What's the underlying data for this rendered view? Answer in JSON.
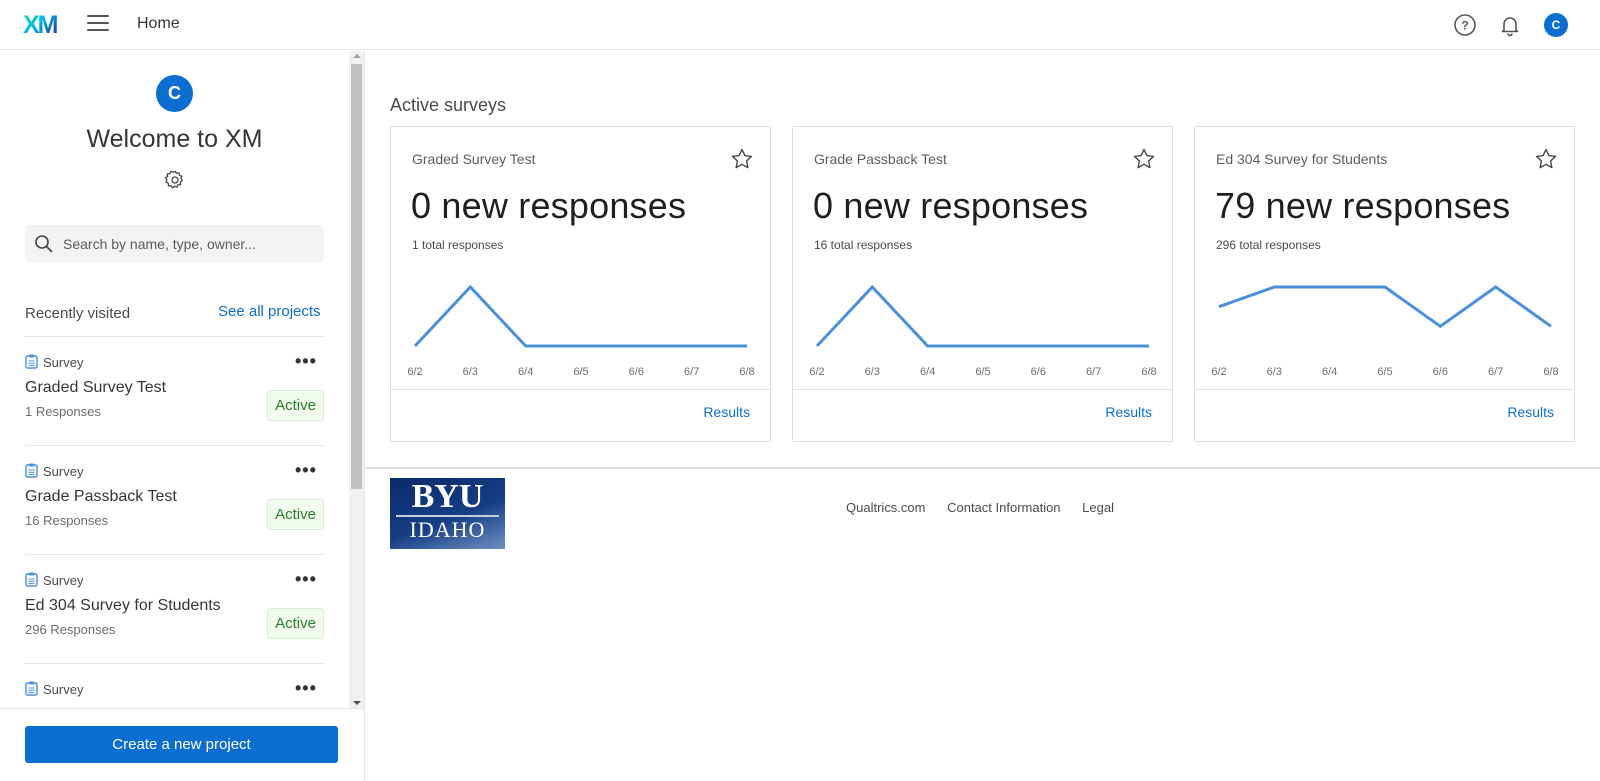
{
  "topbar": {
    "logo": "XM",
    "page_label": "Home",
    "avatar_initial": "C"
  },
  "sidebar": {
    "avatar_initial": "C",
    "welcome": "Welcome to XM",
    "search_placeholder": "Search by name, type, owner...",
    "recent_label": "Recently visited",
    "see_all": "See all projects",
    "projects": [
      {
        "type": "Survey",
        "name": "Graded Survey Test",
        "responses": "1 Responses",
        "status": "Active"
      },
      {
        "type": "Survey",
        "name": "Grade Passback Test",
        "responses": "16 Responses",
        "status": "Active"
      },
      {
        "type": "Survey",
        "name": "Ed 304 Survey for Students",
        "responses": "296 Responses",
        "status": "Active"
      },
      {
        "type": "Survey",
        "name": "",
        "responses": "",
        "status": ""
      }
    ],
    "create_button": "Create a new project"
  },
  "main": {
    "section_title": "Active surveys",
    "cards": [
      {
        "title": "Graded Survey Test",
        "new_responses": "0 new responses",
        "total_responses": "1 total responses",
        "results_label": "Results"
      },
      {
        "title": "Grade Passback Test",
        "new_responses": "0 new responses",
        "total_responses": "16 total responses",
        "results_label": "Results"
      },
      {
        "title": "Ed 304 Survey for Students",
        "new_responses": "79 new responses",
        "total_responses": "296 total responses",
        "results_label": "Results"
      }
    ]
  },
  "chart_data": [
    {
      "type": "line",
      "title": "Graded Survey Test",
      "categories": [
        "6/2",
        "6/3",
        "6/4",
        "6/5",
        "6/6",
        "6/7",
        "6/8"
      ],
      "values": [
        0,
        1,
        0,
        0,
        0,
        0,
        0
      ],
      "xlabel": "",
      "ylabel": ""
    },
    {
      "type": "line",
      "title": "Grade Passback Test",
      "categories": [
        "6/2",
        "6/3",
        "6/4",
        "6/5",
        "6/6",
        "6/7",
        "6/8"
      ],
      "values": [
        0,
        1,
        0,
        0,
        0,
        0,
        0
      ],
      "xlabel": "",
      "ylabel": ""
    },
    {
      "type": "line",
      "title": "Ed 304 Survey for Students",
      "categories": [
        "6/2",
        "6/3",
        "6/4",
        "6/5",
        "6/6",
        "6/7",
        "6/8"
      ],
      "values": [
        2,
        3,
        3,
        3,
        1,
        3,
        1
      ],
      "xlabel": "",
      "ylabel": ""
    }
  ],
  "footer": {
    "logo_top": "BYU",
    "logo_bottom": "IDAHO",
    "links": [
      "Qualtrics.com",
      "Contact Information",
      "Legal"
    ]
  },
  "colors": {
    "accent": "#0b6ed0",
    "line": "#4a90d9",
    "active_badge_text": "#2b7d2b",
    "active_badge_bg": "#f1fbee"
  }
}
